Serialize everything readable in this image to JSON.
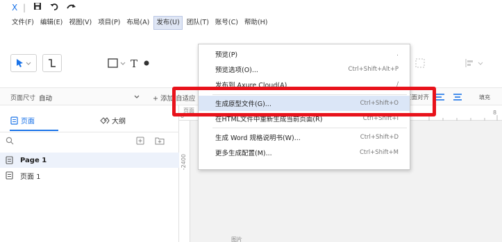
{
  "titlebar": {
    "logo": "X",
    "separator": "|"
  },
  "menubar": {
    "items": [
      {
        "label": "文件(F)"
      },
      {
        "label": "编辑(E)"
      },
      {
        "label": "视图(V)"
      },
      {
        "label": "项目(P)"
      },
      {
        "label": "布局(A)"
      },
      {
        "label": "发布(U)"
      },
      {
        "label": "团队(T)"
      },
      {
        "label": "账号(C)"
      },
      {
        "label": "帮助(H)"
      }
    ],
    "active_index": 5
  },
  "toolbar": {
    "text_tool_glyph": "T"
  },
  "propbar": {
    "page_size_label": "页面尺寸",
    "page_size_value": "自动",
    "add_button": "+ 添加",
    "adapt_label": "自适应",
    "page_align_label": "页面对齐",
    "fill_label": "填充"
  },
  "leftpanel": {
    "tab_pages": "页面",
    "tab_outline": "大纲",
    "search_placeholder": "",
    "pages": [
      {
        "label": "Page 1"
      },
      {
        "label": "页面 1"
      }
    ]
  },
  "canvas": {
    "ruler_tick_top": "页面",
    "ruler_tick_num": "0",
    "vruler_label": "-2400",
    "right_ruler_num": "8"
  },
  "dropdown": {
    "items": [
      {
        "label": "预览(P)",
        "shortcut": "."
      },
      {
        "label": "预览选项(O)...",
        "shortcut": "Ctrl+Shift+Alt+P"
      },
      {
        "label": "发布到 Axure Cloud(A)",
        "shortcut": "/"
      },
      {
        "label": "生成原型文件(G)...",
        "shortcut": "Ctrl+Shift+O"
      },
      {
        "label": "在HTML文件中重新生成当前页面(R)",
        "shortcut": "Ctrl+Shift+I"
      },
      {
        "label": "生成 Word 规格说明书(W)...",
        "shortcut": "Ctrl+Shift+D"
      },
      {
        "label": "更多生成配置(M)...",
        "shortcut": "Ctrl+Shift+M"
      }
    ],
    "highlight_index": 3
  },
  "status": {
    "bottom_text": "图片"
  },
  "colors": {
    "accent_blue": "#1a73e8",
    "highlight_red": "#e8121b",
    "menu_hover": "#dbe6f7"
  }
}
